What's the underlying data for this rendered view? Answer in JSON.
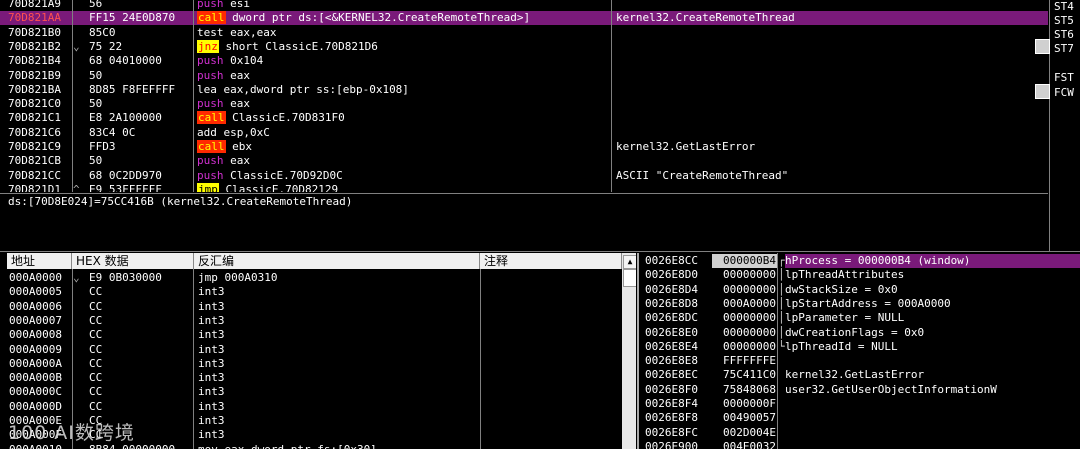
{
  "disasm": {
    "rows": [
      {
        "addr": "70D821A9",
        "hex": "56",
        "arrow": "",
        "ins": "push",
        "ops": "esi",
        "comment": "",
        "cls": "ins-push"
      },
      {
        "addr": "70D821AA",
        "hex": "FF15 24E0D870",
        "arrow": "",
        "ins": "call",
        "ops": "dword ptr ds:[<&KERNEL32.CreateRemoteThread>]",
        "comment": "kernel32.CreateRemoteThread",
        "cls": "ins-call",
        "selected": true
      },
      {
        "addr": "70D821B0",
        "hex": "85C0",
        "arrow": "",
        "ins": "test",
        "ops": "eax,eax",
        "comment": "",
        "cls": "ins-plain"
      },
      {
        "addr": "70D821B2",
        "hex": "75 22",
        "arrow": "⌄",
        "ins": "jnz",
        "ops": "short ClassicE.70D821D6",
        "comment": "",
        "cls": "ins-jnz"
      },
      {
        "addr": "70D821B4",
        "hex": "68 04010000",
        "arrow": "",
        "ins": "push",
        "ops": "0x104",
        "comment": "",
        "cls": "ins-push"
      },
      {
        "addr": "70D821B9",
        "hex": "50",
        "arrow": "",
        "ins": "push",
        "ops": "eax",
        "comment": "",
        "cls": "ins-push"
      },
      {
        "addr": "70D821BA",
        "hex": "8D85 F8FEFFFF",
        "arrow": "",
        "ins": "lea",
        "ops": "eax,dword ptr ss:[ebp-0x108]",
        "comment": "",
        "cls": "ins-plain"
      },
      {
        "addr": "70D821C0",
        "hex": "50",
        "arrow": "",
        "ins": "push",
        "ops": "eax",
        "comment": "",
        "cls": "ins-push"
      },
      {
        "addr": "70D821C1",
        "hex": "E8 2A100000",
        "arrow": "",
        "ins": "call",
        "ops": "ClassicE.70D831F0",
        "comment": "",
        "cls": "ins-call"
      },
      {
        "addr": "70D821C6",
        "hex": "83C4 0C",
        "arrow": "",
        "ins": "add",
        "ops": "esp,0xC",
        "comment": "",
        "cls": "ins-plain"
      },
      {
        "addr": "70D821C9",
        "hex": "FFD3",
        "arrow": "",
        "ins": "call",
        "ops": "ebx",
        "comment": "kernel32.GetLastError",
        "cls": "ins-call"
      },
      {
        "addr": "70D821CB",
        "hex": "50",
        "arrow": "",
        "ins": "push",
        "ops": "eax",
        "comment": "",
        "cls": "ins-push"
      },
      {
        "addr": "70D821CC",
        "hex": "68 0C2DD970",
        "arrow": "",
        "ins": "push",
        "ops": "ClassicE.70D92D0C",
        "comment": "ASCII \"CreateRemoteThread\"",
        "cls": "ins-push"
      },
      {
        "addr": "70D821D1",
        "hex": "E9 53FFFFFF",
        "arrow": "^",
        "ins": "jmp",
        "ops": "ClassicE.70D82129",
        "comment": "",
        "cls": "ins-jmp"
      }
    ]
  },
  "info_line": "ds:[70D8E024]=75CC416B (kernel32.CreateRemoteThread)",
  "registers": [
    "ST4",
    "ST5",
    "ST6",
    "ST7",
    "FST",
    "FCW"
  ],
  "dump": {
    "headers": {
      "addr": "地址",
      "hex": "HEX 数据",
      "disasm": "反汇编",
      "comment": "注释"
    },
    "rows": [
      {
        "addr": "000A0000",
        "arrow": "⌄",
        "hex": "E9 0B030000",
        "dis": "jmp 000A0310"
      },
      {
        "addr": "000A0005",
        "arrow": "",
        "hex": "CC",
        "dis": "int3"
      },
      {
        "addr": "000A0006",
        "arrow": "",
        "hex": "CC",
        "dis": "int3"
      },
      {
        "addr": "000A0007",
        "arrow": "",
        "hex": "CC",
        "dis": "int3"
      },
      {
        "addr": "000A0008",
        "arrow": "",
        "hex": "CC",
        "dis": "int3"
      },
      {
        "addr": "000A0009",
        "arrow": "",
        "hex": "CC",
        "dis": "int3"
      },
      {
        "addr": "000A000A",
        "arrow": "",
        "hex": "CC",
        "dis": "int3"
      },
      {
        "addr": "000A000B",
        "arrow": "",
        "hex": "CC",
        "dis": "int3"
      },
      {
        "addr": "000A000C",
        "arrow": "",
        "hex": "CC",
        "dis": "int3"
      },
      {
        "addr": "000A000D",
        "arrow": "",
        "hex": "CC",
        "dis": "int3"
      },
      {
        "addr": "000A000E",
        "arrow": "",
        "hex": "CC",
        "dis": "int3"
      },
      {
        "addr": "000A000F",
        "arrow": "",
        "hex": "CC",
        "dis": "int3"
      },
      {
        "addr": "000A0010",
        "arrow": "",
        "hex": "8B84 00000000",
        "dis": "mov eax,dword ptr fs:[0x30]"
      }
    ]
  },
  "stack": {
    "rows": [
      {
        "addr": "0026E8CC",
        "val": "000000B4",
        "bracket": "┌",
        "desc": "hProcess = 000000B4 (window)",
        "selected": true
      },
      {
        "addr": "0026E8D0",
        "val": "00000000",
        "bracket": "│",
        "desc": "lpThreadAttributes"
      },
      {
        "addr": "0026E8D4",
        "val": "00000000",
        "bracket": "│",
        "desc": "dwStackSize = 0x0"
      },
      {
        "addr": "0026E8D8",
        "val": "000A0000",
        "bracket": "│",
        "desc": "lpStartAddress = 000A0000"
      },
      {
        "addr": "0026E8DC",
        "val": "00000000",
        "bracket": "│",
        "desc": "lpParameter = NULL"
      },
      {
        "addr": "0026E8E0",
        "val": "00000000",
        "bracket": "│",
        "desc": "dwCreationFlags = 0x0"
      },
      {
        "addr": "0026E8E4",
        "val": "00000000",
        "bracket": "└",
        "desc": "lpThreadId = NULL"
      },
      {
        "addr": "0026E8E8",
        "val": "FFFFFFFE",
        "bracket": "",
        "desc": ""
      },
      {
        "addr": "0026E8EC",
        "val": "75C411C0",
        "bracket": "",
        "desc": "kernel32.GetLastError"
      },
      {
        "addr": "0026E8F0",
        "val": "75848068",
        "bracket": "",
        "desc": "user32.GetUserObjectInformationW"
      },
      {
        "addr": "0026E8F4",
        "val": "0000000F",
        "bracket": "",
        "desc": ""
      },
      {
        "addr": "0026E8F8",
        "val": "00490057",
        "bracket": "",
        "desc": ""
      },
      {
        "addr": "0026E8FC",
        "val": "002D004E",
        "bracket": "",
        "desc": ""
      },
      {
        "addr": "0026E900",
        "val": "004E0032",
        "bracket": "",
        "desc": ""
      }
    ]
  },
  "watermark": "100 AI数跨境",
  "colors": {
    "selection": "#7a1a7a",
    "call_bg": "#ff2a00",
    "jmp_bg": "#ffff00",
    "push_fg": "#d030d0"
  }
}
